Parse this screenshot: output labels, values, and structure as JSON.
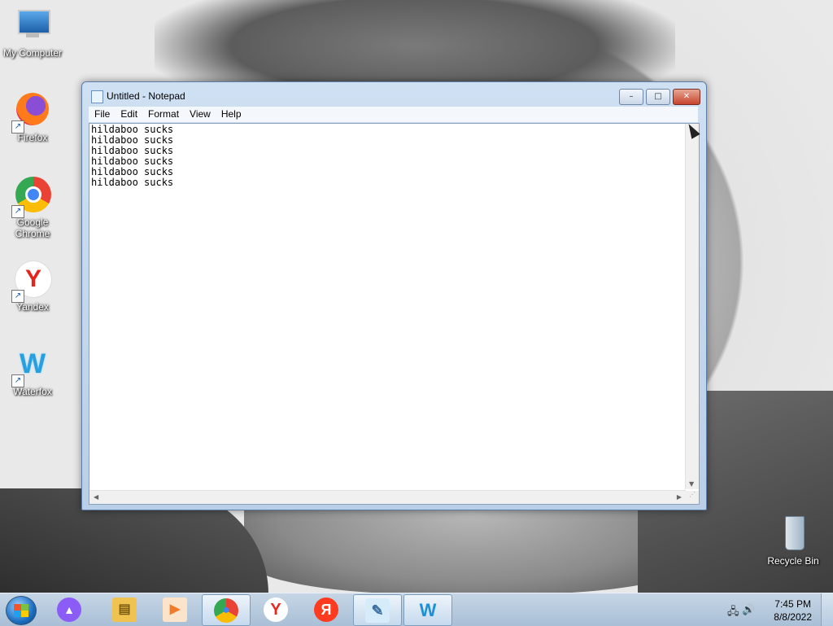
{
  "desktop": {
    "icons": [
      {
        "label": "My Computer",
        "icon": "computer-icon"
      },
      {
        "label": "Firefox",
        "icon": "firefox-icon"
      },
      {
        "label": "Google Chrome",
        "icon": "chrome-icon"
      },
      {
        "label": "Yandex",
        "icon": "yandex-icon"
      },
      {
        "label": "Waterfox",
        "icon": "waterfox-icon"
      },
      {
        "label": "Recycle Bin",
        "icon": "recycle-bin-icon"
      }
    ]
  },
  "window": {
    "title": "Untitled - Notepad",
    "controls": {
      "minimize": "–",
      "maximize": "□",
      "close": "✕"
    },
    "menu": [
      "File",
      "Edit",
      "Format",
      "View",
      "Help"
    ],
    "content": "hildaboo sucks\nhildaboo sucks\nhildaboo sucks\nhildaboo sucks\nhildaboo sucks\nhildaboo sucks"
  },
  "taskbar": {
    "apps": [
      {
        "name": "alice-icon",
        "glyph": "▲",
        "color": "#8b5cf6"
      },
      {
        "name": "file-explorer-icon",
        "glyph": "▤",
        "color": "#f0c350"
      },
      {
        "name": "media-player-icon",
        "glyph": "▶",
        "color": "#f07b2a"
      },
      {
        "name": "chrome-icon",
        "glyph": "●",
        "color": "#34a853"
      },
      {
        "name": "yandex-browser-icon",
        "glyph": "Y",
        "color": "#e62a22"
      },
      {
        "name": "yandex-icon",
        "glyph": "Я",
        "color": "#ff3b1f"
      },
      {
        "name": "notepad-icon",
        "glyph": "✎",
        "color": "#6fa8dc"
      },
      {
        "name": "waterfox-icon",
        "glyph": "W",
        "color": "#1e90d6"
      }
    ],
    "clock": {
      "time": "7:45 PM",
      "date": "8/8/2022"
    }
  }
}
